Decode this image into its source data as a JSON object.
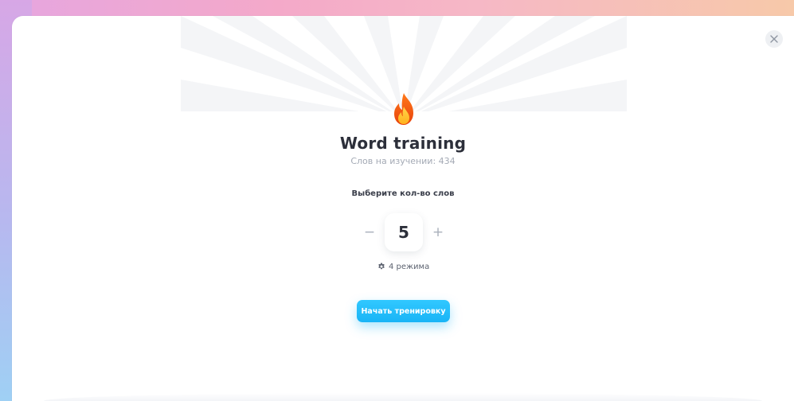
{
  "modal": {
    "title": "Word training",
    "subtitle": "Слов на изучении: 434",
    "choose_label": "Выберите кол-во слов",
    "stepper": {
      "minus": "−",
      "value": "5",
      "plus": "+"
    },
    "modes_label": "4 режима",
    "start_button": "Начать тренировку"
  },
  "icons": {
    "close": "close-icon",
    "fire": "fire-icon",
    "gear": "gear-icon"
  },
  "colors": {
    "accent": "#19b4f6",
    "title": "#2c2f3a",
    "muted": "#a4aab5"
  }
}
